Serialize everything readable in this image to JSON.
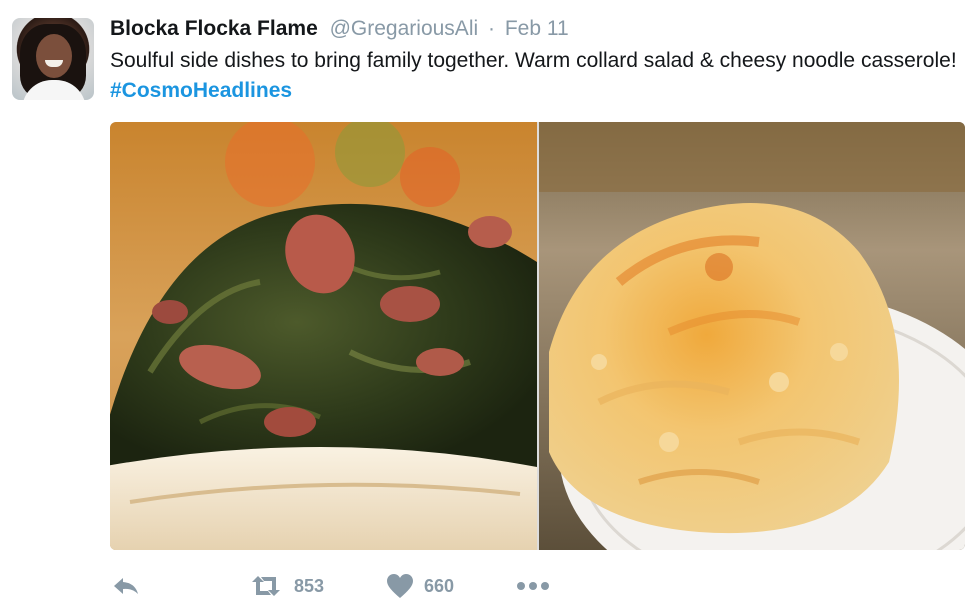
{
  "tweet": {
    "author_name": "Blocka Flocka Flame",
    "author_handle": "@GregariousAli",
    "separator": "·",
    "date": "Feb 11",
    "text": "Soulful side dishes to bring family together. Warm collard salad & cheesy noodle casserole! ",
    "hashtag": "#CosmoHeadlines",
    "colors": {
      "hashtag": "#1b95e0",
      "meta": "#8899a6",
      "text": "#14171a"
    }
  },
  "media": {
    "photos": [
      {
        "name": "collard-greens-photo",
        "subject": "collard greens with ham in white dish"
      },
      {
        "name": "mac-and-cheese-photo",
        "subject": "baked cheesy macaroni on white plate"
      }
    ]
  },
  "actions": {
    "reply_icon": "reply-icon",
    "retweet_icon": "retweet-icon",
    "retweet_count": "853",
    "like_icon": "heart-icon",
    "like_count": "660",
    "more_icon": "more-icon"
  }
}
